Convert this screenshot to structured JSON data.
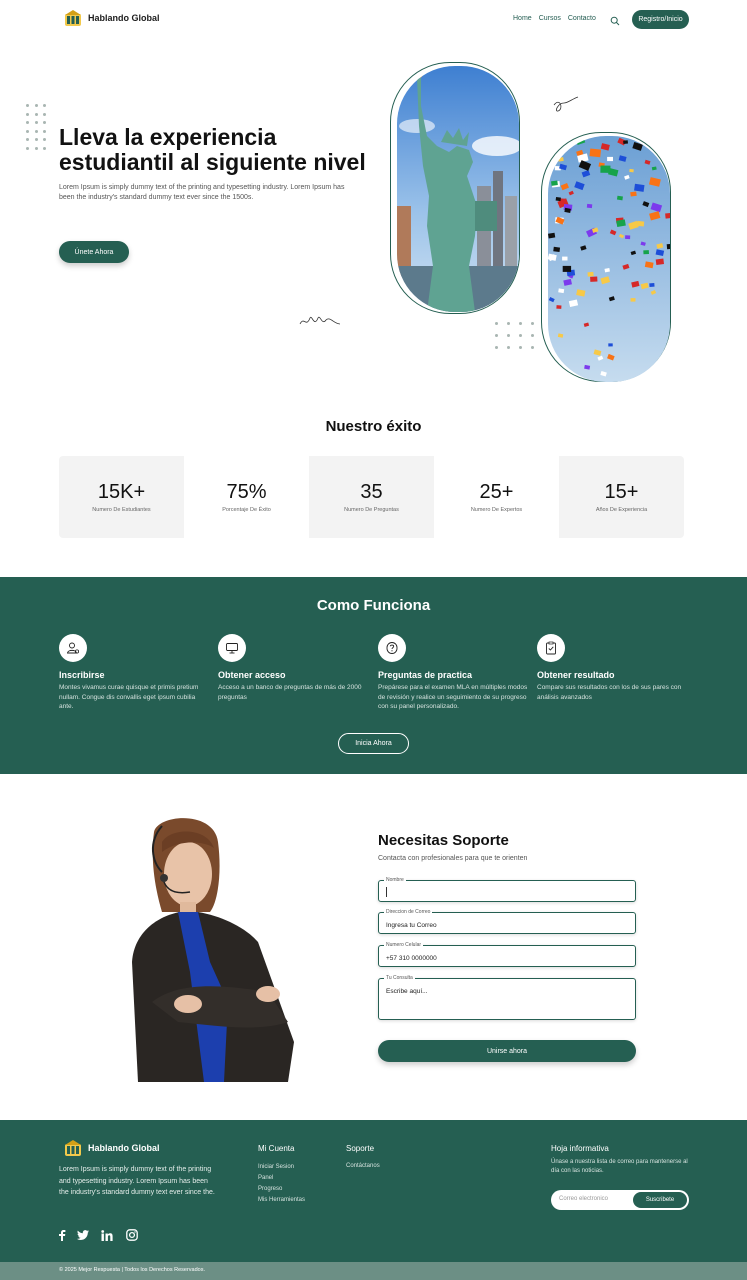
{
  "nav": {
    "brand": "Hablando Global",
    "links": [
      "Home",
      "Cursos",
      "Contacto"
    ],
    "cta": "Registro/Inicio"
  },
  "hero": {
    "title_line1": "Lleva la experiencia",
    "title_line2": "estudiantil al siguiente nivel",
    "subtitle": "Lorem Ipsum is simply dummy text of the printing and typesetting industry. Lorem Ipsum has been the industry's standard dummy text ever since the 1500s.",
    "button": "Únete Ahora"
  },
  "stats": {
    "title": "Nuestro éxito",
    "items": [
      {
        "value": "15K+",
        "label": "Numero De Estudiantes"
      },
      {
        "value": "75%",
        "label": "Porcentaje De Éxito"
      },
      {
        "value": "35",
        "label": "Numero De Preguntas"
      },
      {
        "value": "25+",
        "label": "Numero De Expertos"
      },
      {
        "value": "15+",
        "label": "Años De Experiencia"
      }
    ]
  },
  "how": {
    "title": "Como Funciona",
    "steps": [
      {
        "title": "Inscribirse",
        "desc": "Montes vivamus curae quisque et primis pretium nullam. Congue dis convallis eget ipsum cubilia ante.",
        "icon": "user-icon"
      },
      {
        "title": "Obtener acceso",
        "desc": "Acceso a un banco de preguntas de más de 2000 preguntas",
        "icon": "monitor-icon"
      },
      {
        "title": "Preguntas de practica",
        "desc": "Prepárese para el examen MLA en múltiples modos de revisión y realice un seguimiento de su progreso con su panel personalizado.",
        "icon": "question-icon"
      },
      {
        "title": "Obtener resultado",
        "desc": "Compare sus resultados con los de sus pares con análisis avanzados",
        "icon": "clipboard-check-icon"
      }
    ],
    "button": "Inicia Ahora"
  },
  "support": {
    "title": "Necesitas Soporte",
    "subtitle": "Contacta con profesionales para que te orienten",
    "fields": [
      {
        "label": "Nombre",
        "value": ""
      },
      {
        "label": "Direccion de Correo",
        "value": "Ingresa tu Correo"
      },
      {
        "label": "Numero Celular",
        "value": "+57 310 0000000"
      },
      {
        "label": "Tu Consulta",
        "value": "Escribe aquí..."
      }
    ],
    "button": "Unirse ahora"
  },
  "footer": {
    "brand": "Hablando Global",
    "desc": "Lorem Ipsum is simply dummy text of the printing and typesetting industry. Lorem Ipsum has been the industry's standard dummy text ever since the.",
    "account_title": "Mi Cuenta",
    "account_links": [
      "Iniciar Sesion",
      "Panel",
      "Progreso",
      "Mis Herramientas"
    ],
    "support_title": "Soporte",
    "support_links": [
      "Contáctanos"
    ],
    "news_title": "Hoja informativa",
    "news_desc": "Únase a nuestra lista de correo para mantenerse al día con las noticias.",
    "news_placeholder": "Correo electronico",
    "news_button": "Suscribete",
    "copyright": "© 2025 Mejor Respuesta | Todos los Derechos Reservados.",
    "social_icons": [
      "facebook-icon",
      "twitter-icon",
      "linkedin-icon",
      "instagram-icon"
    ]
  },
  "colors": {
    "primary": "#255f52",
    "footer_bottom": "#6c8f85",
    "stats_bg": "#f3f3f3"
  }
}
